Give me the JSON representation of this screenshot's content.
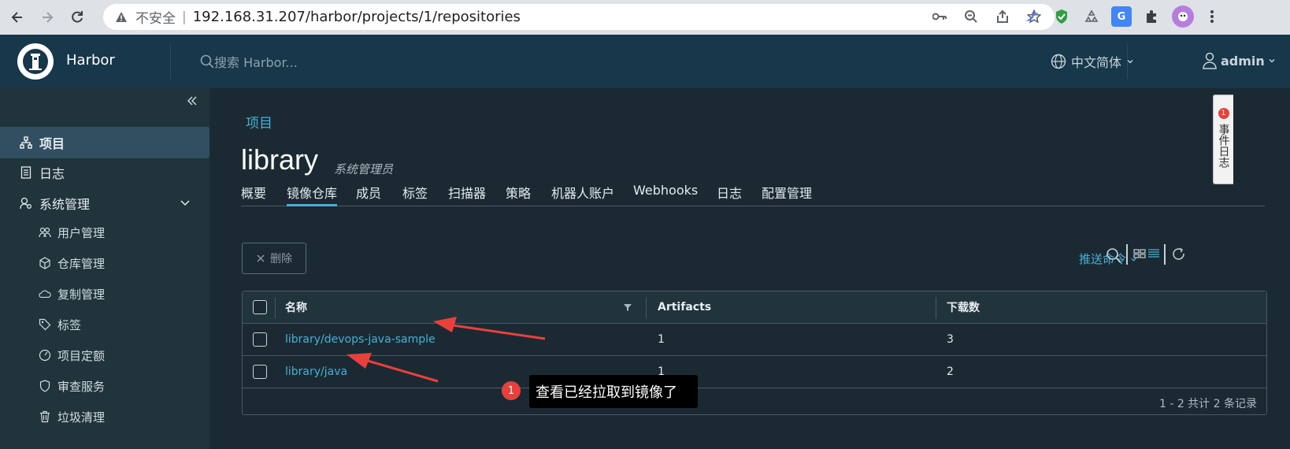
{
  "browser": {
    "security_label": "不安全",
    "url": "192.168.31.207/harbor/projects/1/repositories"
  },
  "header": {
    "brand": "Harbor",
    "search_placeholder": "搜索 Harbor...",
    "language": "中文简体",
    "user": "admin"
  },
  "sidebar": {
    "items": [
      {
        "label": "项目",
        "icon": "projects-icon"
      },
      {
        "label": "日志",
        "icon": "logs-icon"
      },
      {
        "label": "系统管理",
        "icon": "admin-icon"
      }
    ],
    "sub_items": [
      {
        "label": "用户管理",
        "icon": "users-icon"
      },
      {
        "label": "仓库管理",
        "icon": "registry-icon"
      },
      {
        "label": "复制管理",
        "icon": "replication-icon"
      },
      {
        "label": "标签",
        "icon": "tag-icon"
      },
      {
        "label": "项目定额",
        "icon": "quota-icon"
      },
      {
        "label": "审查服务",
        "icon": "shield-icon"
      },
      {
        "label": "垃圾清理",
        "icon": "trash-icon"
      }
    ]
  },
  "main": {
    "breadcrumb": "项目",
    "title": "library",
    "role": "系统管理员",
    "tabs": [
      "概要",
      "镜像仓库",
      "成员",
      "标签",
      "扫描器",
      "策略",
      "机器人账户",
      "Webhooks",
      "日志",
      "配置管理"
    ],
    "delete_label": "删除",
    "push_command": "推送命令",
    "table": {
      "headers": [
        "名称",
        "Artifacts",
        "下载数"
      ],
      "rows": [
        {
          "name": "library/devops-java-sample",
          "artifacts": "1",
          "downloads": "3"
        },
        {
          "name": "library/java",
          "artifacts": "1",
          "downloads": "2"
        }
      ],
      "footer": "1 - 2 共计 2 条记录"
    }
  },
  "annotation": {
    "number": "1",
    "text": "查看已经拉取到镜像了"
  },
  "event_panel": {
    "count": "1",
    "label": "事件日志"
  },
  "colors": {
    "accent": "#49afd9",
    "header_bg": "#17374a",
    "sidebar_bg": "#21333b",
    "main_bg": "#1b2a32",
    "arrow": "#e8413c"
  }
}
